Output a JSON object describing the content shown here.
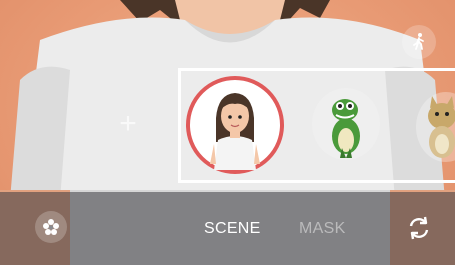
{
  "modes": {
    "scene": "SCENE",
    "mask": "MASK"
  },
  "colors": {
    "background": "#e89a74",
    "selected_ring": "#e05a5a",
    "highlight_border": "#ffffff"
  },
  "icons": {
    "top_right": "walking-person-icon",
    "bottom_left": "flower-effects-icon",
    "bottom_right": "switch-camera-icon",
    "add": "plus-icon"
  },
  "emoji_items": [
    {
      "name": "my-emoji-avatar",
      "selected": true
    },
    {
      "name": "dinosaur-sticker",
      "selected": false
    },
    {
      "name": "cat-sticker",
      "selected": false
    }
  ]
}
